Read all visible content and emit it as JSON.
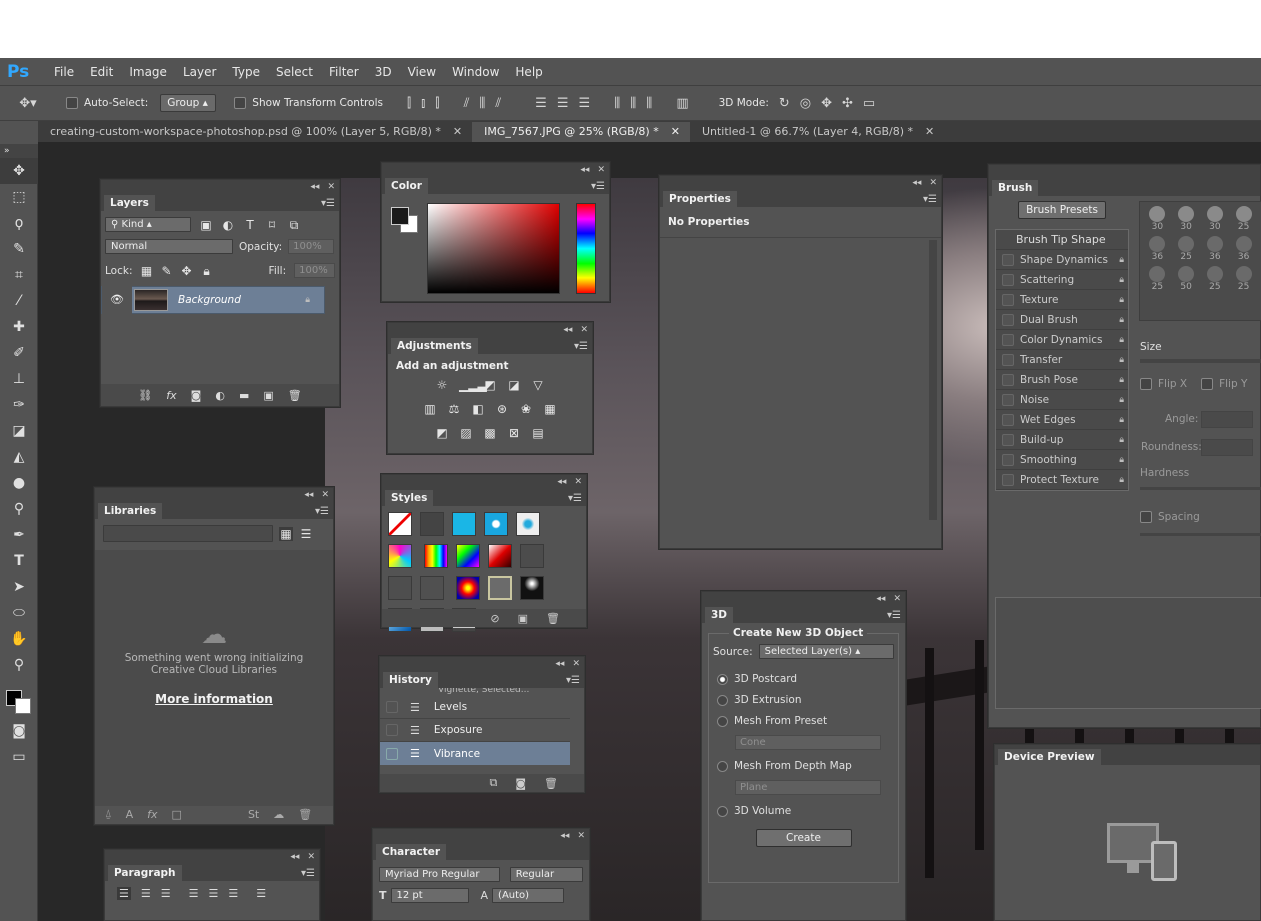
{
  "app": {
    "logo": "Ps"
  },
  "menu": [
    "File",
    "Edit",
    "Image",
    "Layer",
    "Type",
    "Select",
    "Filter",
    "3D",
    "View",
    "Window",
    "Help"
  ],
  "options": {
    "auto_select_label": "Auto-Select:",
    "auto_select_value": "Group",
    "show_transform": "Show Transform Controls",
    "mode_3d": "3D Mode:"
  },
  "tabs": [
    {
      "label": "creating-custom-workspace-photoshop.psd @ 100% (Layer 5, RGB/8) *",
      "active": false
    },
    {
      "label": "IMG_7567.JPG @ 25% (RGB/8) *",
      "active": true
    },
    {
      "label": "Untitled-1 @ 66.7% (Layer 4, RGB/8) *",
      "active": false
    }
  ],
  "layers": {
    "title": "Layers",
    "kind": "Kind",
    "blend": "Normal",
    "opacity_label": "Opacity:",
    "opacity_value": "100%",
    "lock_label": "Lock:",
    "fill_label": "Fill:",
    "fill_value": "100%",
    "layer_name": "Background"
  },
  "color": {
    "title": "Color",
    "fg": "#1a1a1a",
    "bg": "#ffffff"
  },
  "properties": {
    "title": "Properties",
    "message": "No Properties"
  },
  "adjustments": {
    "title": "Adjustments",
    "subtitle": "Add an adjustment"
  },
  "styles": {
    "title": "Styles"
  },
  "history": {
    "title": "History",
    "items": [
      {
        "label": "Vignette, Selected..."
      },
      {
        "label": "Levels"
      },
      {
        "label": "Exposure"
      },
      {
        "label": "Vibrance"
      }
    ]
  },
  "libraries": {
    "title": "Libraries",
    "error_line1": "Something went wrong initializing",
    "error_line2": "Creative Cloud Libraries",
    "more_info": "More information"
  },
  "three_d": {
    "title": "3D",
    "section": "Create New 3D Object",
    "source_label": "Source:",
    "source_value": "Selected Layer(s)",
    "opt_postcard": "3D Postcard",
    "opt_extrusion": "3D Extrusion",
    "opt_mesh_preset": "Mesh From Preset",
    "preset_value": "Cone",
    "opt_depth": "Mesh From Depth Map",
    "depth_value": "Plane",
    "opt_volume": "3D Volume",
    "create": "Create"
  },
  "brush": {
    "title": "Brush",
    "presets_button": "Brush Presets",
    "tip_shape": "Brush Tip Shape",
    "options": [
      "Shape Dynamics",
      "Scattering",
      "Texture",
      "Dual Brush",
      "Color Dynamics",
      "Transfer",
      "Brush Pose",
      "Noise",
      "Wet Edges",
      "Build-up",
      "Smoothing",
      "Protect Texture"
    ],
    "sizes": [
      [
        "30",
        "30",
        "30",
        "25"
      ],
      [
        "36",
        "25",
        "36",
        "36"
      ],
      [
        "25",
        "50",
        "25",
        "25"
      ]
    ],
    "size_label": "Size",
    "flipx": "Flip X",
    "flipy": "Flip Y",
    "angle": "Angle:",
    "roundness": "Roundness:",
    "hardness": "Hardness",
    "spacing": "Spacing"
  },
  "device_preview": {
    "title": "Device Preview"
  },
  "paragraph": {
    "title": "Paragraph"
  },
  "character": {
    "title": "Character",
    "font": "Myriad Pro Regular",
    "style": "Regular",
    "size": "12 pt",
    "leading": "(Auto)"
  }
}
